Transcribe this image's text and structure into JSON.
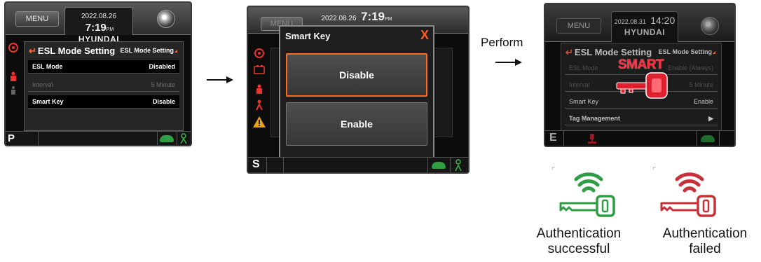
{
  "screen1": {
    "menu_label": "MENU",
    "date": "2022.08.26",
    "time": "7:19",
    "ampm": "PM",
    "brand": "HYUNDAI",
    "panel_title": "ESL Mode Setting",
    "panel_subtitle": "ESL Mode Setting",
    "rows": [
      {
        "label": "ESL Mode",
        "value": "Disabled"
      },
      {
        "label": "Interval",
        "value": "5 Minute"
      },
      {
        "label": "Smart Key",
        "value": "Disable"
      }
    ],
    "gear": "P"
  },
  "screen2": {
    "menu_label": "MENU",
    "date": "2022.08.26",
    "time": "7:19",
    "ampm": "PM",
    "dialog_title": "Smart Key",
    "close_label": "X",
    "options": [
      "Disable",
      "Enable"
    ],
    "gear": "S"
  },
  "flow": {
    "perform_label": "Perform"
  },
  "screen3": {
    "menu_label": "MENU",
    "date": "2022.08.31",
    "time": "14:20",
    "brand": "HYUNDAI",
    "panel_title": "ESL Mode Setting",
    "panel_subtitle": "ESL Mode Setting",
    "rows": [
      {
        "label": "ESL Mode",
        "value": "Enable (Always)"
      },
      {
        "label": "Interval",
        "value": "5 Minute"
      },
      {
        "label": "Smart Key",
        "value": "Enable"
      },
      {
        "label": "Tag Management",
        "value": "▶"
      }
    ],
    "overlay_text": "SMART",
    "gear": "E"
  },
  "auth": {
    "success_line1": "Authentication",
    "success_line2": "successful",
    "fail_line1": "Authentication",
    "fail_line2": "failed"
  },
  "colors": {
    "success": "#2f9e44",
    "failure": "#c9303a",
    "accent": "#ff6a1f"
  },
  "icons": [
    "engine-warning-icon",
    "battery-icon",
    "seat-belt-icon",
    "warning-triangle-icon",
    "turtle-icon",
    "smart-key-icon",
    "wireless-key-icon"
  ]
}
